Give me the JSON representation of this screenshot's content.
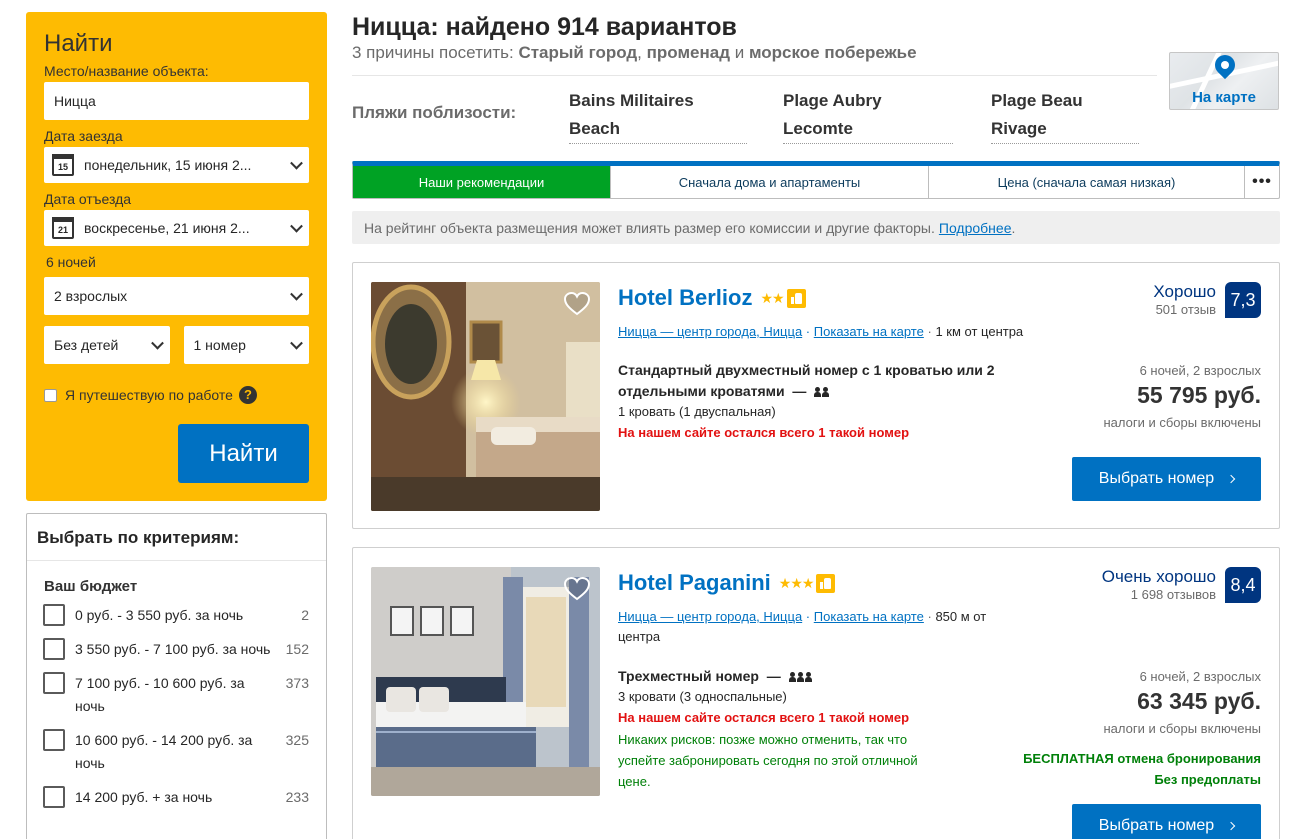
{
  "search": {
    "title": "Найти",
    "destination_label": "Место/название объекта:",
    "destination_value": "Ницца",
    "checkin_label": "Дата заезда",
    "checkin_icon_day": "15",
    "checkin_value": "понедельник, 15 июня 2...",
    "checkout_label": "Дата отъезда",
    "checkout_icon_day": "21",
    "checkout_value": "воскресенье, 21 июня 2...",
    "nights": "6 ночей",
    "adults": "2 взрослых",
    "children": "Без детей",
    "rooms": "1 номер",
    "work_travel": "Я путешествую по работе",
    "help_glyph": "?",
    "button": "Найти"
  },
  "filters": {
    "title": "Выбрать по критериям:",
    "budget_title": "Ваш бюджет",
    "budget": [
      {
        "label": "0 руб. - 3 550 руб. за ночь",
        "count": "2"
      },
      {
        "label": "3 550 руб. - 7 100 руб. за ночь",
        "count": "152"
      },
      {
        "label": "7 100 руб. - 10 600 руб. за ночь",
        "count": "373"
      },
      {
        "label": "10 600 руб. - 14 200 руб. за ночь",
        "count": "325"
      },
      {
        "label": "14 200 руб. + за ночь",
        "count": "233"
      }
    ]
  },
  "header": {
    "title": "Ницца: найдено 914 вариантов",
    "reasons_prefix": "3 причины посетить: ",
    "reason_1": "Старый город",
    "sep_1": ", ",
    "reason_2": "променад",
    "sep_2": " и ",
    "reason_3": "морское побережье",
    "map_label": "На карте",
    "beaches_label": "Пляжи поблизости:",
    "beaches": [
      {
        "line1": "Bains Militaires",
        "line2": "Beach"
      },
      {
        "line1": "Plage Aubry",
        "line2": "Lecomte"
      },
      {
        "line1": "Plage Beau",
        "line2": "Rivage"
      }
    ]
  },
  "sort": {
    "tabs": [
      "Наши рекомендации",
      "Сначала дома и апартаменты",
      "Цена (сначала самая низкая)"
    ],
    "more": "•••"
  },
  "notice": {
    "text": "На рейтинг объекта размещения может влиять размер его комиссии и другие факторы.",
    "link": "Подробнее",
    "tail": "."
  },
  "hotels": [
    {
      "name": "Hotel Berlioz",
      "stars": "★★",
      "location_link": "Ницца — центр города, Ницца",
      "map_link": "Показать на карте",
      "distance": "1 км от центра",
      "room_line1": "Стандартный двухместный номер с 1 кроватью или 2",
      "room_line2": "отдельными кроватями",
      "dash": "—",
      "beds": "1 кровать (1 двуспальная)",
      "warning": "На нашем сайте остался всего 1 такой номер",
      "score_word": "Хорошо",
      "reviews": "501 отзыв",
      "score": "7,3",
      "stay": "6 ночей, 2 взрослых",
      "price": "55 795 руб.",
      "tax": "налоги и сборы включены",
      "button": "Выбрать номер"
    },
    {
      "name": "Hotel Paganini",
      "stars": "★★★",
      "location_link": "Ницца — центр города, Ницца",
      "map_link": "Показать на карте",
      "distance_line1": "850 м от",
      "distance_line2": "центра",
      "room_name": "Трехместный номер",
      "dash": "—",
      "beds": "3 кровати (3 односпальные)",
      "warning": "На нашем сайте остался всего 1 такой номер",
      "no_risk_1": "Никаких рисков: позже можно отменить, так что",
      "no_risk_2": "успейте забронировать сегодня по этой отличной",
      "no_risk_3": "цене.",
      "score_word": "Очень хорошо",
      "reviews": "1 698 отзывов",
      "score": "8,4",
      "stay": "6 ночей, 2 взрослых",
      "price": "63 345 руб.",
      "tax": "налоги и сборы включены",
      "free_cancel": "БЕСПЛАТНАЯ отмена бронирования",
      "no_prepay": "Без предоплаты",
      "button": "Выбрать номер"
    }
  ],
  "colors": {
    "accent_blue": "#0071c2",
    "dark_blue": "#003580",
    "yellow": "#febb02",
    "green": "#00a224",
    "red": "#e21111"
  }
}
